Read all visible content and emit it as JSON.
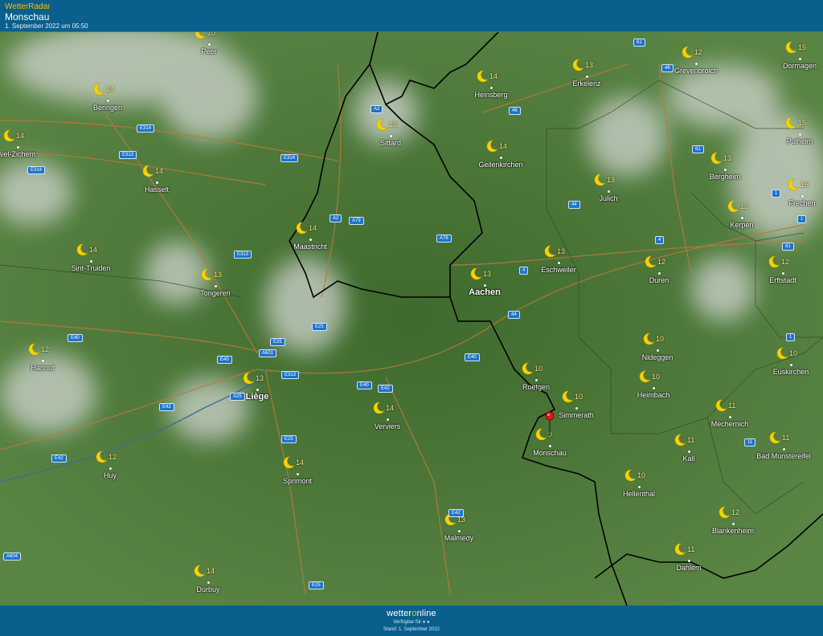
{
  "header": {
    "brand": "WetterRadar",
    "location": "Monschau",
    "timestamp": "1. September 2022 um 05:50"
  },
  "footer": {
    "logo_left": "wetter",
    "logo_o": "o",
    "logo_right": "nline",
    "available": "Verfügbar für",
    "stand": "Stand: 1. September 2022"
  },
  "icons": {
    "moon": "crescent-moon-icon",
    "pin": "location-pin-icon"
  },
  "colors": {
    "header": "#0b5f8c",
    "terrain": "#4f7a3a",
    "border": "#000000",
    "road": "#b87a3a",
    "moon": "#f6d200",
    "temp": "#f6e27a",
    "pin": "#d9191b"
  },
  "places": [
    {
      "name": "Peer",
      "temp": "10"
    },
    {
      "name": "Beringen",
      "temp": "14"
    },
    {
      "name": "vel-Zichem",
      "temp": "14"
    },
    {
      "name": "Hasselt",
      "temp": "14"
    },
    {
      "name": "Sint-Truiden",
      "temp": "14"
    },
    {
      "name": "Tongeren",
      "temp": "13"
    },
    {
      "name": "Hannut",
      "temp": "12"
    },
    {
      "name": "Huy",
      "temp": "12"
    },
    {
      "name": "Durbuy",
      "temp": "14"
    },
    {
      "name": "Liège",
      "temp": "13"
    },
    {
      "name": "Sprimont",
      "temp": "14"
    },
    {
      "name": "Verviers",
      "temp": "14"
    },
    {
      "name": "Malmedy",
      "temp": "13"
    },
    {
      "name": "Maastricht",
      "temp": "14"
    },
    {
      "name": "Sittard",
      "temp": "13"
    },
    {
      "name": "Heinsberg",
      "temp": "14"
    },
    {
      "name": "Geilenkirchen",
      "temp": "14"
    },
    {
      "name": "Erkelenz",
      "temp": "13"
    },
    {
      "name": "Aachen",
      "temp": "13"
    },
    {
      "name": "Eschweiler",
      "temp": "13"
    },
    {
      "name": "Julich",
      "temp": "13"
    },
    {
      "name": "Roetgen",
      "temp": "10"
    },
    {
      "name": "Simmerath",
      "temp": "10"
    },
    {
      "name": "Monschau",
      "temp": "9"
    },
    {
      "name": "Grevenbroich",
      "temp": "12"
    },
    {
      "name": "Dormagen",
      "temp": "15"
    },
    {
      "name": "Pulheim",
      "temp": "15"
    },
    {
      "name": "Bergheim",
      "temp": "13"
    },
    {
      "name": "Frechen",
      "temp": "15"
    },
    {
      "name": "Kerpen",
      "temp": "13"
    },
    {
      "name": "Duren",
      "temp": "12"
    },
    {
      "name": "Erftstadt",
      "temp": "12"
    },
    {
      "name": "Nideggen",
      "temp": "10"
    },
    {
      "name": "Heimbach",
      "temp": "10"
    },
    {
      "name": "Euskirchen",
      "temp": "10"
    },
    {
      "name": "Mechernich",
      "temp": "11"
    },
    {
      "name": "Kall",
      "temp": "11"
    },
    {
      "name": "Bad Munstereifel",
      "temp": "11"
    },
    {
      "name": "Hellenthal",
      "temp": "10"
    },
    {
      "name": "Blankenheim",
      "temp": "12"
    },
    {
      "name": "Dahlem",
      "temp": "11"
    }
  ],
  "roads": [
    "E314",
    "E313",
    "E314",
    "E314",
    "E313",
    "A2",
    "A2",
    "A79",
    "A76",
    "46",
    "61",
    "46",
    "61",
    "44",
    "4",
    "4",
    "1",
    "61",
    "1",
    "4",
    "44",
    "E40",
    "E40",
    "E40",
    "E40",
    "E42",
    "E42",
    "E42",
    "E42",
    "E25",
    "E25",
    "E25",
    "E25",
    "A601",
    "E313",
    "A25",
    "A604",
    "11",
    "1",
    "1"
  ]
}
